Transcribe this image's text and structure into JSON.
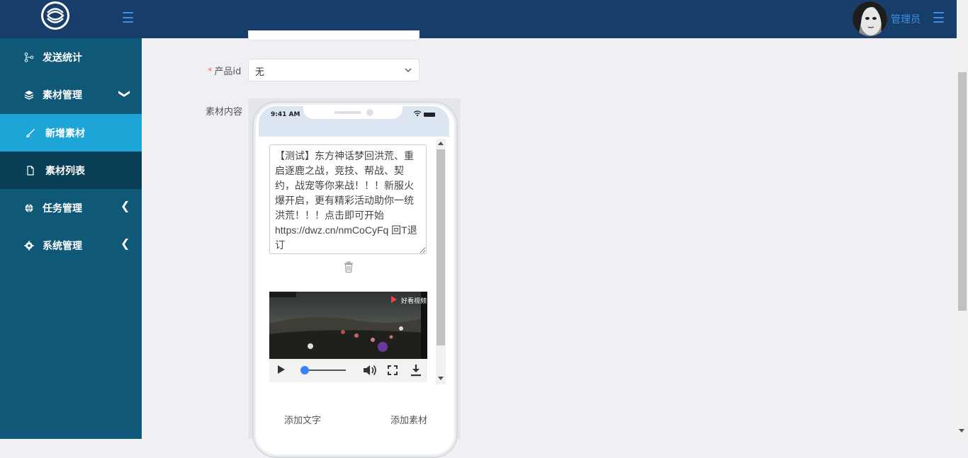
{
  "header": {
    "admin_name": "管理员"
  },
  "sidebar": {
    "items": [
      {
        "label": "发送统计"
      },
      {
        "label": "素材管理",
        "arrow": "❯"
      },
      {
        "label": "新增素材"
      },
      {
        "label": "素材列表"
      },
      {
        "label": "任务管理",
        "arrow": "❮"
      },
      {
        "label": "系统管理",
        "arrow": "❮"
      }
    ]
  },
  "form": {
    "product_id": {
      "required_mark": "*",
      "label": "产品id",
      "value": "无"
    },
    "content_label": "素材内容"
  },
  "phone": {
    "time": "9:41 AM",
    "text_content": "【测试】东方神话梦回洪荒、重启逐鹿之战，竞技、帮战、契约，战宠等你来战！！！新服火爆开启，更有精彩活动助你一统洪荒！！！点击即可开始 https://dwz.cn/nmCoCyFq 回T退订",
    "video_brand": "好看视频",
    "video_progress": 0,
    "add_text_label": "添加文字",
    "add_material_label": "添加素材"
  },
  "colors": {
    "header_bg": "#173d6a",
    "sidebar_bg": "#0f5878",
    "sidebar_active": "#1ea5d8",
    "accent": "#3d8ee2"
  }
}
